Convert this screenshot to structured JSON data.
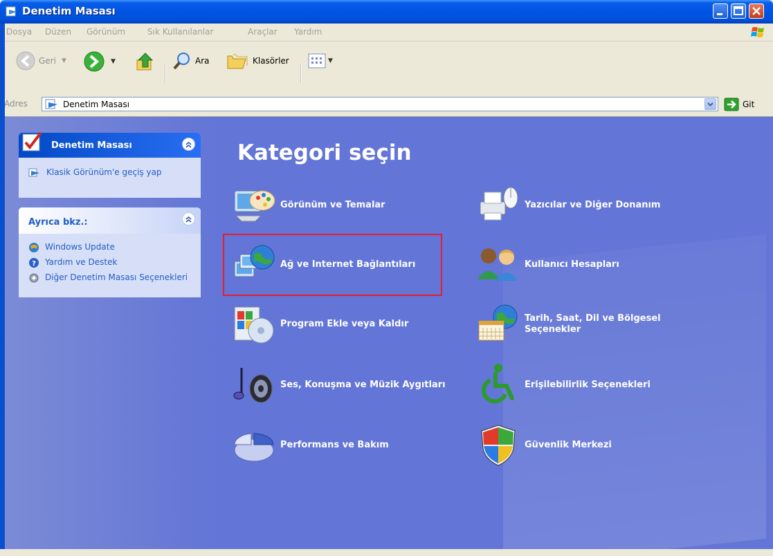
{
  "window": {
    "title": "Denetim Masası"
  },
  "menu": [
    "Dosya",
    "Düzen",
    "Görünüm",
    "Sık Kullanılanlar",
    "Araçlar",
    "Yardım"
  ],
  "toolbar": {
    "back": "Geri",
    "search": "Ara",
    "folders": "Klasörler"
  },
  "address": {
    "label": "Adres",
    "value": "Denetim Masası",
    "go": "Git"
  },
  "sidebar": {
    "control_panel_box": {
      "title": "Denetim Masası",
      "link": "Klasik Görünüm'e geçiş yap"
    },
    "see_also_box": {
      "title": "Ayrıca bkz.:",
      "links": [
        "Windows Update",
        "Yardım ve Destek",
        "Diğer Denetim Masası Seçenekleri"
      ]
    }
  },
  "main": {
    "heading": "Kategori seçin",
    "categories_left": [
      "Görünüm ve Temalar",
      "Ağ ve Internet Bağlantıları",
      "Program Ekle veya Kaldır",
      "Ses, Konuşma ve Müzik Aygıtları",
      "Performans ve Bakım"
    ],
    "categories_right": [
      "Yazıcılar ve Diğer Donanım",
      "Kullanıcı Hesapları",
      "Tarih, Saat, Dil ve Bölgesel Seçenekler",
      "Erişilebilirlik Seçenekleri",
      "Güvenlik Merkezi"
    ]
  },
  "colors": {
    "content_bg": "#6375d6",
    "title_bar": "#0054e3",
    "highlight": "#e81d2f",
    "link": "#215dc6"
  }
}
